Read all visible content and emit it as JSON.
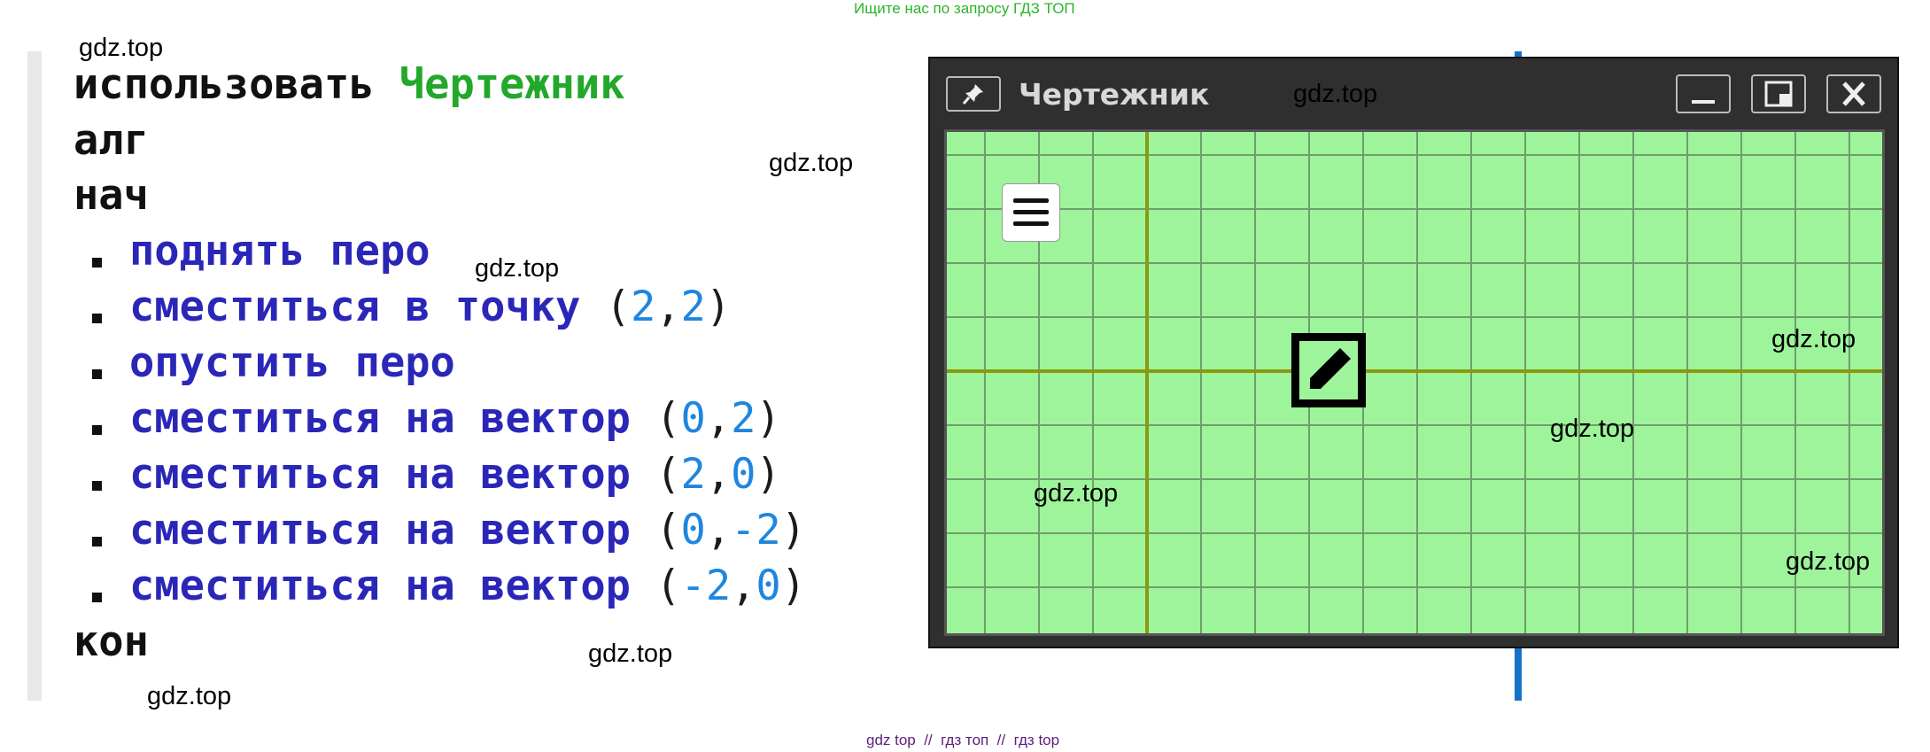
{
  "banner_top": "Ищите нас по запросу ГДЗ ТОП",
  "banner_bottom": "gdz top  //  гдз топ  //  гдз top",
  "watermark": "gdz.top",
  "program": {
    "use_kw": "использовать",
    "executor": "Чертежник",
    "alg_kw": "алг",
    "begin_kw": "нач",
    "end_kw": "кон",
    "commands": [
      {
        "text": "поднять перо",
        "open": "",
        "a": "",
        "sep": "",
        "b": "",
        "close": ""
      },
      {
        "text": "сместиться в точку ",
        "open": "(",
        "a": "2",
        "sep": ",",
        "b": "2",
        "close": ")"
      },
      {
        "text": "опустить перо",
        "open": "",
        "a": "",
        "sep": "",
        "b": "",
        "close": ""
      },
      {
        "text": "сместиться на вектор ",
        "open": "(",
        "a": "0",
        "sep": ",",
        "b": "2",
        "close": ")"
      },
      {
        "text": "сместиться на вектор ",
        "open": "(",
        "a": "2",
        "sep": ",",
        "b": "0",
        "close": ")"
      },
      {
        "text": "сместиться на вектор ",
        "open": "(",
        "a": "0",
        "sep": ",",
        "b": "-2",
        "close": ")"
      },
      {
        "text": "сместиться на вектор ",
        "open": "(",
        "a": "-2",
        "sep": ",",
        "b": "0",
        "close": ")"
      }
    ]
  },
  "window": {
    "title": "Чертежник",
    "pin_icon": "pin-icon",
    "buttons": [
      "minimize-icon",
      "restore-icon",
      "close-icon"
    ]
  },
  "colors": {
    "canvas": "#9ef49b",
    "grid": "#6e9e6c",
    "axis": "#8a9a10",
    "executor": "#22a82a",
    "command": "#2a27b8",
    "number": "#1e86e0"
  }
}
